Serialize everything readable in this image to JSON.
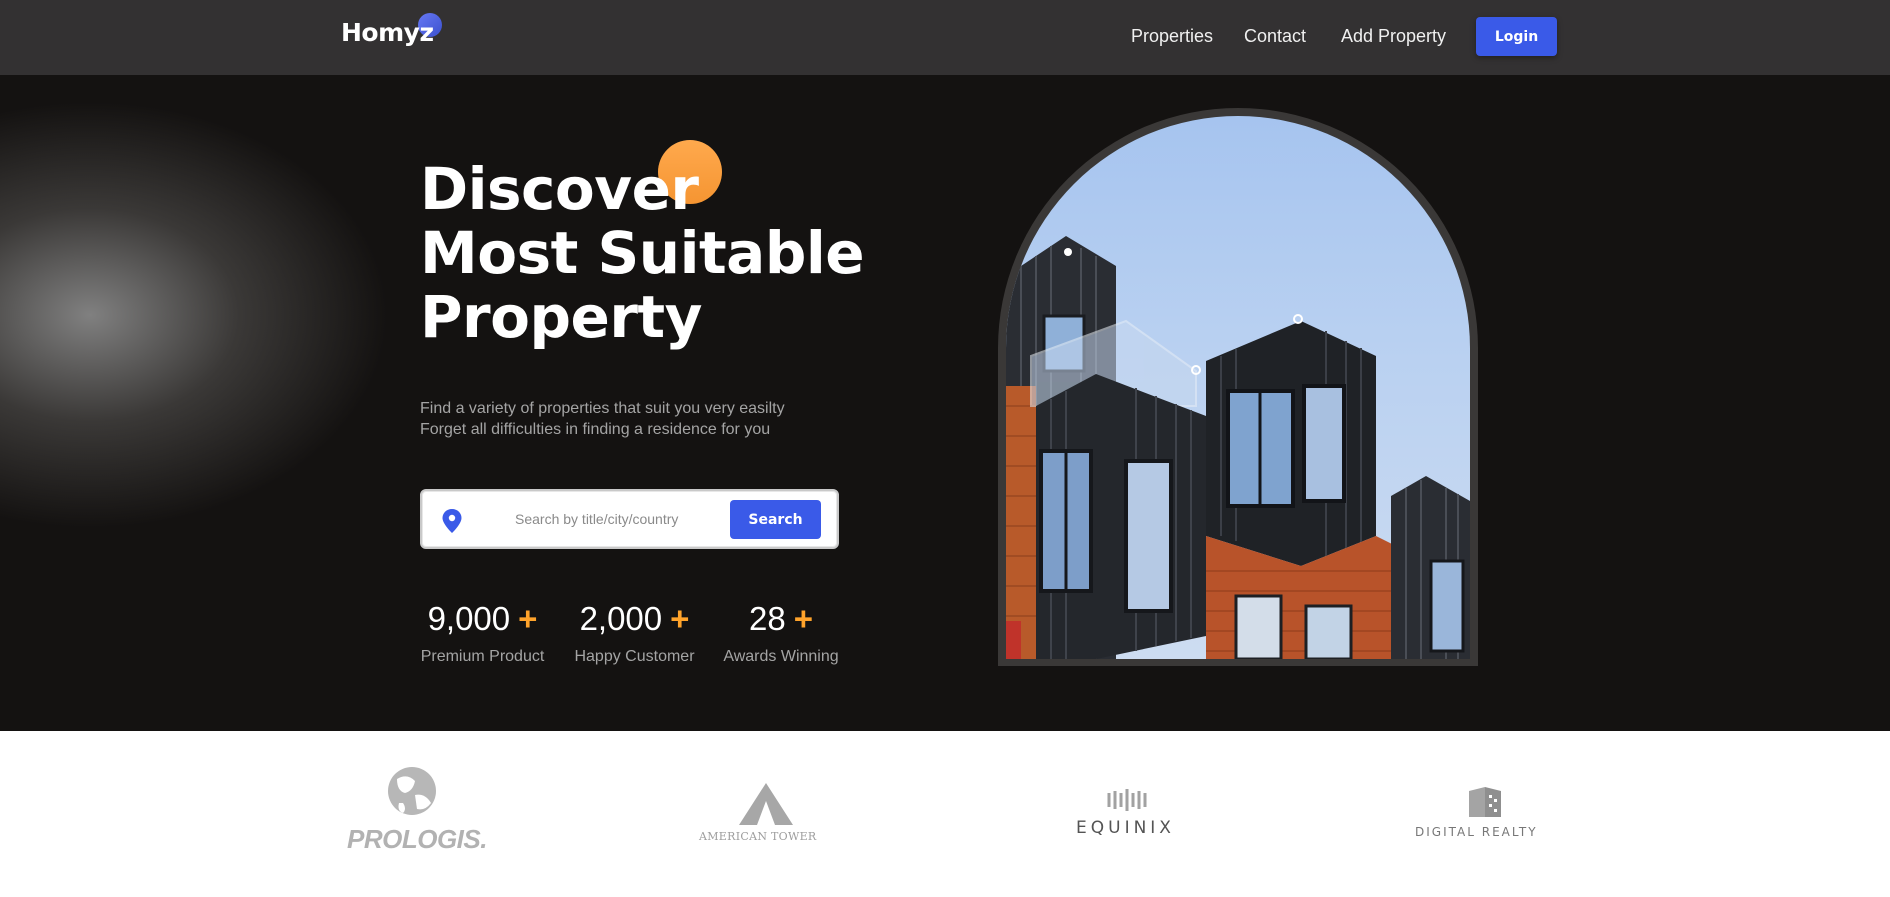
{
  "header": {
    "logo": "Homyz",
    "nav": [
      "Properties",
      "Contact",
      "Add Property"
    ],
    "login_label": "Login"
  },
  "hero": {
    "title_lines": [
      "Discover",
      "Most Suitable",
      "Property"
    ],
    "subtitle_lines": [
      "Find a variety of properties that suit you very easilty",
      "Forget all difficulties in finding a residence for you"
    ],
    "search": {
      "placeholder": "Search by title/city/country",
      "button_label": "Search"
    },
    "stats": [
      {
        "value": "9,000",
        "suffix": "+",
        "label": "Premium Product"
      },
      {
        "value": "2,000",
        "suffix": "+",
        "label": "Happy Customer"
      },
      {
        "value": "28",
        "suffix": "+",
        "label": "Awards Winning"
      }
    ]
  },
  "partners": [
    "PROLOGIS.",
    "AMERICAN TOWER",
    "EQUINIX",
    "DIGITAL REALTY"
  ],
  "colors": {
    "header_bg": "#333132",
    "hero_bg": "#141211",
    "accent_blue": "#3a5ae8",
    "accent_orange": "#ffa32b"
  }
}
